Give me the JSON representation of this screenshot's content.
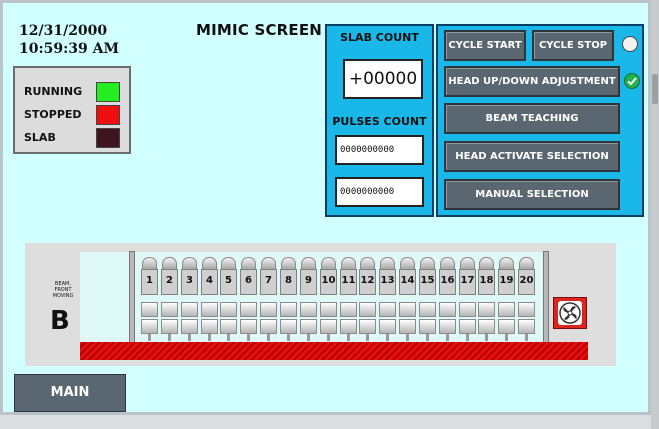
{
  "header": {
    "date": "12/31/2000",
    "time": "10:59:39 AM",
    "title": "MIMIC SCREEN"
  },
  "legend": {
    "items": [
      {
        "label": "RUNNING",
        "color": "#22ee22"
      },
      {
        "label": "STOPPED",
        "color": "#ee1010"
      },
      {
        "label": "SLAB",
        "color": "#3e1420"
      }
    ]
  },
  "counts": {
    "slab_label": "SLAB COUNT",
    "slab_value": "+00000",
    "pulses_label": "PULSES COUNT",
    "pulses_value_1": "0000000000",
    "pulses_value_2": "0000000000"
  },
  "controls": {
    "cycle_start": "CYCLE START",
    "cycle_stop": "CYCLE STOP",
    "head_updown": "HEAD UP/DOWN ADJUSTMENT",
    "beam_teaching": "BEAM TEACHING",
    "head_activate": "HEAD ACTIVATE SELECTION",
    "manual_selection": "MANUAL SELECTION"
  },
  "machine": {
    "beam_label": "BEAM, FRONT MOVING",
    "beam_letter": "B",
    "rollers": [
      "1",
      "2",
      "3",
      "4",
      "5",
      "6",
      "7",
      "8",
      "9",
      "10",
      "11",
      "12",
      "13",
      "14",
      "15",
      "16",
      "17",
      "18",
      "19",
      "20"
    ]
  },
  "nav": {
    "main": "MAIN"
  },
  "colors": {
    "background": "#d2ffff",
    "panel": "#19b8e8",
    "button": "#5a6670",
    "floor": "#e41010",
    "indicator_ok": "#22b14c"
  }
}
